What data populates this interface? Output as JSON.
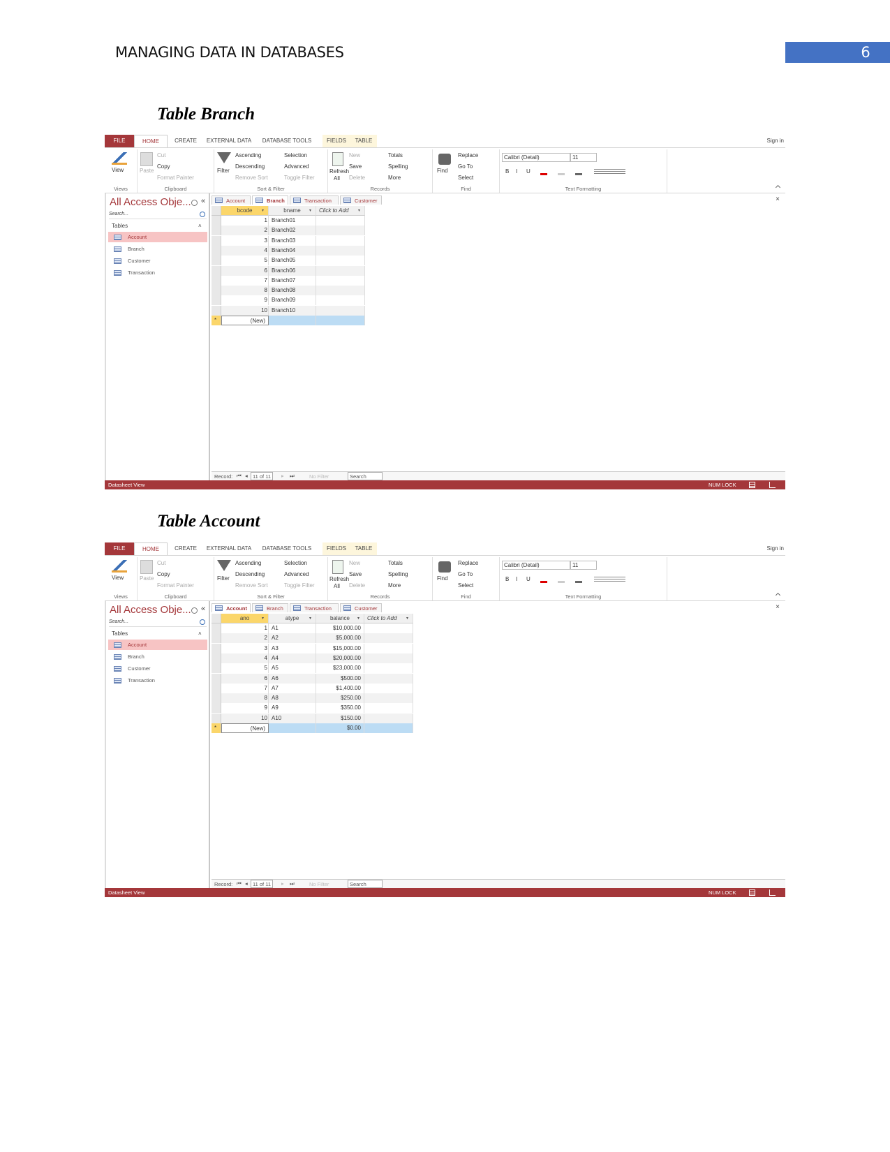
{
  "page": {
    "header": "MANAGING DATA IN DATABASES",
    "page_number": "6",
    "accent": "#4472c4"
  },
  "captions": [
    "Table Branch",
    "Table Account"
  ],
  "access": {
    "menu_tabs": [
      "FILE",
      "HOME",
      "CREATE",
      "EXTERNAL DATA",
      "DATABASE TOOLS",
      "FIELDS",
      "TABLE"
    ],
    "sign_in": "Sign in",
    "ribbon": {
      "views": {
        "label": "Views",
        "view": "View"
      },
      "clipboard": {
        "label": "Clipboard",
        "paste": "Paste",
        "cut": "Cut",
        "copy": "Copy",
        "format_painter": "Format Painter"
      },
      "sort_filter": {
        "label": "Sort & Filter",
        "filter": "Filter",
        "ascending": "Ascending",
        "descending": "Descending",
        "remove_sort": "Remove Sort",
        "selection": "Selection",
        "advanced": "Advanced",
        "toggle_filter": "Toggle Filter"
      },
      "records": {
        "label": "Records",
        "refresh": "Refresh",
        "all": "All",
        "new": "New",
        "save": "Save",
        "delete": "Delete",
        "totals": "Totals",
        "spelling": "Spelling",
        "more": "More"
      },
      "find": {
        "label": "Find",
        "find": "Find",
        "replace": "Replace",
        "goto": "Go To",
        "select": "Select"
      },
      "text_formatting": {
        "label": "Text Formatting",
        "font": "Calibri (Detail)",
        "size": "11",
        "bold": "B",
        "italic": "I",
        "underline": "U"
      }
    },
    "nav": {
      "title": "All Access Obje...",
      "search_placeholder": "Search...",
      "section": "Tables",
      "items": [
        "Account",
        "Branch",
        "Customer",
        "Transaction"
      ],
      "selected": "Account"
    },
    "doc_tabs": [
      "Account",
      "Branch",
      "Transaction",
      "Customer"
    ],
    "record_bar": {
      "label": "Record:",
      "position": "11 of 11",
      "no_filter": "No Filter",
      "search": "Search"
    },
    "status": {
      "view": "Datasheet View",
      "num_lock": "NUM LOCK"
    },
    "brand_color": "#a4373a"
  },
  "windows": [
    {
      "active_tab": "Branch",
      "columns": [
        "bcode",
        "bname",
        "Click to Add"
      ],
      "rows": [
        [
          "1",
          "Branch01",
          ""
        ],
        [
          "2",
          "Branch02",
          ""
        ],
        [
          "3",
          "Branch03",
          ""
        ],
        [
          "4",
          "Branch04",
          ""
        ],
        [
          "5",
          "Branch05",
          ""
        ],
        [
          "6",
          "Branch06",
          ""
        ],
        [
          "7",
          "Branch07",
          ""
        ],
        [
          "8",
          "Branch08",
          ""
        ],
        [
          "9",
          "Branch09",
          ""
        ],
        [
          "10",
          "Branch10",
          ""
        ]
      ],
      "new_row": [
        "(New)",
        "",
        ""
      ]
    },
    {
      "active_tab": "Account",
      "columns": [
        "ano",
        "atype",
        "balance",
        "Click to Add"
      ],
      "rows": [
        [
          "1",
          "A1",
          "$10,000.00",
          ""
        ],
        [
          "2",
          "A2",
          "$5,000.00",
          ""
        ],
        [
          "3",
          "A3",
          "$15,000.00",
          ""
        ],
        [
          "4",
          "A4",
          "$20,000.00",
          ""
        ],
        [
          "5",
          "A5",
          "$23,000.00",
          ""
        ],
        [
          "6",
          "A6",
          "$500.00",
          ""
        ],
        [
          "7",
          "A7",
          "$1,400.00",
          ""
        ],
        [
          "8",
          "A8",
          "$250.00",
          ""
        ],
        [
          "9",
          "A9",
          "$350.00",
          ""
        ],
        [
          "10",
          "A10",
          "$150.00",
          ""
        ]
      ],
      "new_row": [
        "(New)",
        "",
        "$0.00",
        ""
      ]
    }
  ]
}
